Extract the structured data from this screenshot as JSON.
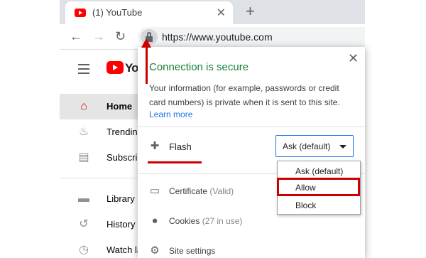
{
  "browser": {
    "tab": {
      "title": "(1) YouTube",
      "close_glyph": "✕"
    },
    "new_tab_glyph": "+",
    "back_glyph": "←",
    "forward_glyph": "→",
    "reload_glyph": "↻",
    "url": "https://www.youtube.com"
  },
  "youtube": {
    "logo_text": "You",
    "nav_items": [
      {
        "label": "Home",
        "icon": "home-icon",
        "glyph": "⌂",
        "active": true
      },
      {
        "label": "Trending",
        "icon": "flame-icon",
        "glyph": "♨",
        "active": false
      },
      {
        "label": "Subscriptions",
        "icon": "subscriptions-icon",
        "glyph": "▤",
        "active": false
      },
      {
        "label": "Library",
        "icon": "folder-icon",
        "glyph": "▬",
        "active": false
      },
      {
        "label": "History",
        "icon": "history-icon",
        "glyph": "↺",
        "active": false
      },
      {
        "label": "Watch later",
        "icon": "clock-icon",
        "glyph": "◷",
        "active": false
      }
    ]
  },
  "popup": {
    "close_glyph": "✕",
    "title": "Connection is secure",
    "description": "Your information (for example, passwords or credit card numbers) is private when it is sent to this site.",
    "learn_more": "Learn more",
    "flash": {
      "label": "Flash",
      "icon_glyph": "✚",
      "selected": "Ask (default)",
      "options": [
        "Ask (default)",
        "Allow",
        "Block"
      ]
    },
    "rows": [
      {
        "label": "Certificate",
        "sub": "(Valid)",
        "icon": "certificate-icon",
        "glyph": "▭"
      },
      {
        "label": "Cookies",
        "sub": "(27 in use)",
        "icon": "cookie-icon",
        "glyph": "●"
      },
      {
        "label": "Site settings",
        "sub": "",
        "icon": "gear-icon",
        "glyph": "⚙"
      }
    ]
  },
  "colors": {
    "secure_green": "#188038",
    "link_blue": "#1a73e8",
    "annotation_red": "#cc0000",
    "youtube_red": "#ff0000"
  }
}
